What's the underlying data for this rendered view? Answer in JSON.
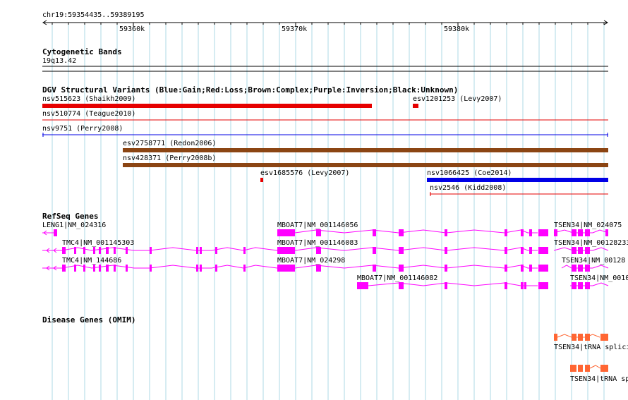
{
  "ruler": {
    "position": "chr19:59354435..59389195",
    "ticks": [
      "59360k",
      "59370k",
      "59380k"
    ]
  },
  "cytoband": {
    "title": "Cytogenetic Bands",
    "band": "19q13.42"
  },
  "dgv": {
    "title": "DGV Structural Variants (Blue:Gain;Red:Loss;Brown:Complex;Purple:Inversion;Black:Unknown)",
    "variants": [
      {
        "label": "nsv515623 (Shaikh2009)",
        "type": "loss",
        "style": "thick"
      },
      {
        "label": "esv1201253 (Levy2007)",
        "type": "loss",
        "style": "thick"
      },
      {
        "label": "nsv510774 (Teague2010)",
        "type": "loss",
        "style": "thin"
      },
      {
        "label": "nsv9751 (Perry2008)",
        "type": "gain",
        "style": "thin"
      },
      {
        "label": "esv2758771 (Redon2006)",
        "type": "complex",
        "style": "thick"
      },
      {
        "label": "nsv428371 (Perry2008b)",
        "type": "complex",
        "style": "thick"
      },
      {
        "label": "esv1685576 (Levy2007)",
        "type": "loss",
        "style": "thick"
      },
      {
        "label": "nsv1066425 (Coe2014)",
        "type": "gain",
        "style": "thick"
      },
      {
        "label": "nsv2546 (Kidd2008)",
        "type": "loss",
        "style": "thin"
      }
    ]
  },
  "refseq": {
    "title": "RefSeq Genes",
    "genes": [
      {
        "label": "LENG1|NM_024316"
      },
      {
        "label": "MBOAT7|NM_001146056"
      },
      {
        "label": "TSEN34|NM_024075"
      },
      {
        "label": "TMC4|NM_001145303"
      },
      {
        "label": "MBOAT7|NM_001146083"
      },
      {
        "label": "TSEN34|NM_00128233"
      },
      {
        "label": "TMC4|NM_144686"
      },
      {
        "label": "MBOAT7|NM_024298"
      },
      {
        "label": "TSEN34|NM_00128"
      },
      {
        "label": "MBOAT7|NM_001146082"
      },
      {
        "label": "TSEN34|NM_0010"
      }
    ]
  },
  "omim": {
    "title": "Disease Genes (OMIM)",
    "genes": [
      {
        "label": "TSEN34|tRNA splici"
      },
      {
        "label": "TSEN34|tRNA sp"
      }
    ]
  },
  "colors": {
    "loss": "#e60000",
    "gain": "#0000e6",
    "complex": "#8b4513",
    "gene": "#ff00ff",
    "omim": "#ff6633",
    "grid": "#add8e6"
  }
}
